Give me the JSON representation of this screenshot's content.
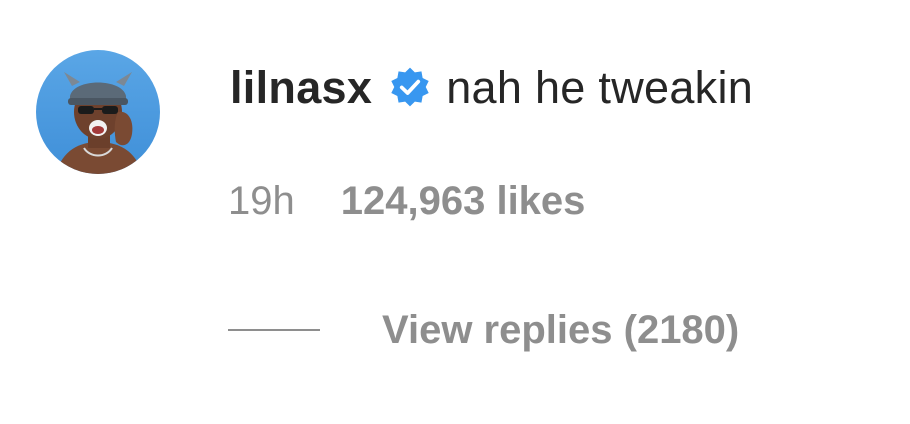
{
  "comment": {
    "username": "lilnasx",
    "verified": true,
    "text": "nah he tweakin",
    "timestamp": "19h",
    "likes": "124,963 likes",
    "view_replies": "View replies (2180)"
  },
  "colors": {
    "primary_text": "#262626",
    "secondary_text": "#8e8e8e",
    "verified_badge": "#3897f0"
  },
  "icons": {
    "verified": "verified-badge-icon",
    "avatar": "profile-avatar"
  }
}
